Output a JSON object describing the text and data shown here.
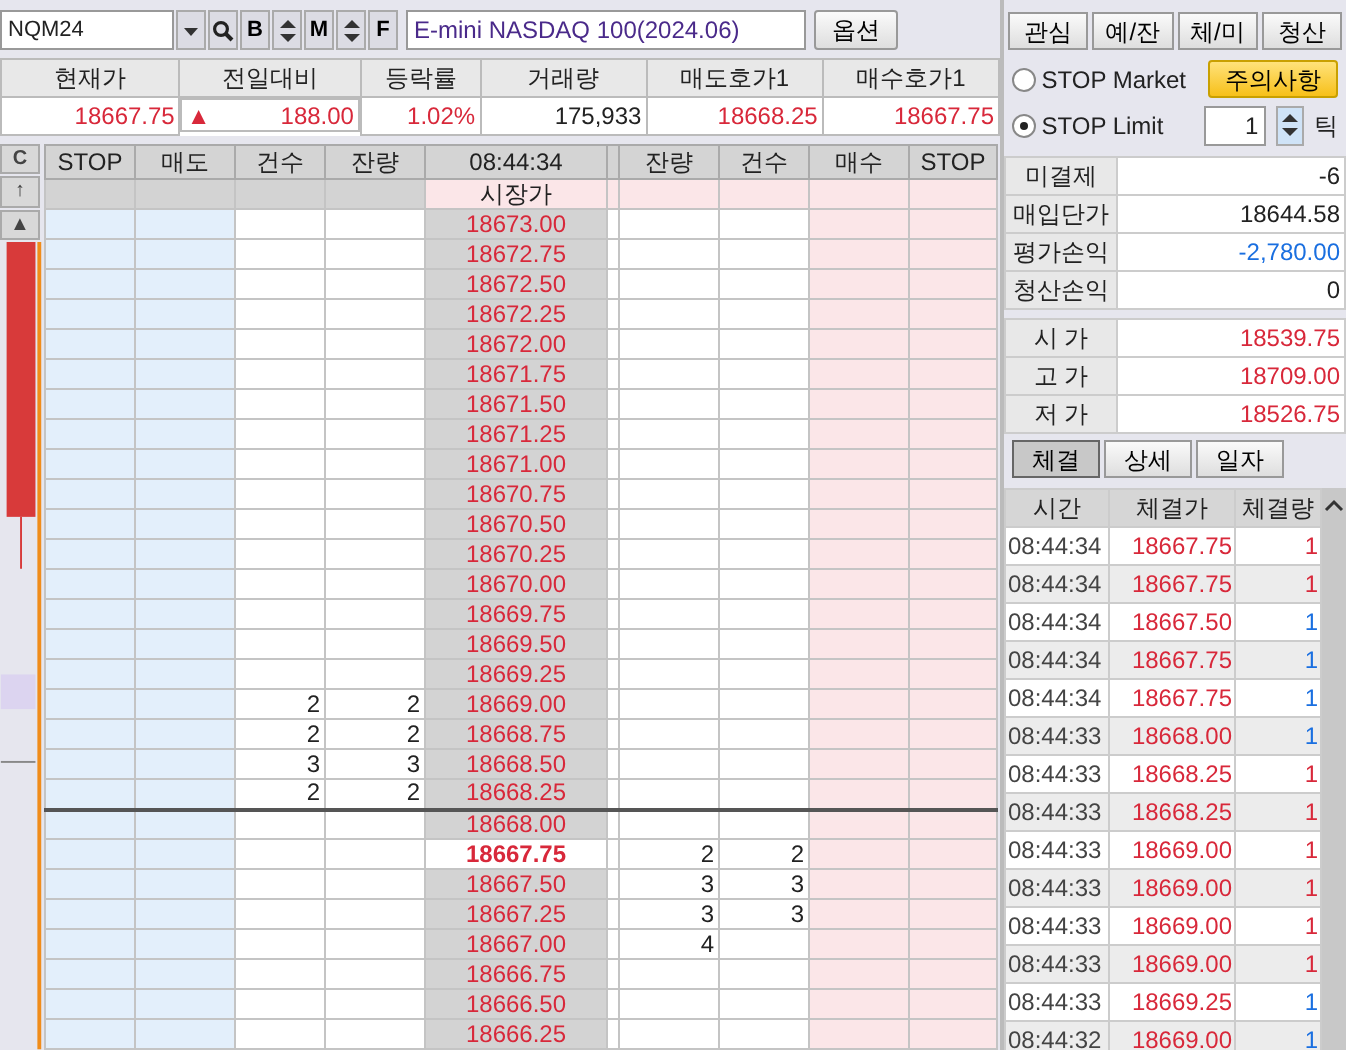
{
  "toolbar": {
    "symbol": "NQM24",
    "product_name": "E-mini NASDAQ 100(2024.06)",
    "option_button": "옵션",
    "tool_buttons": [
      "B",
      "M",
      "F"
    ]
  },
  "quote": {
    "columns": [
      "현재가",
      "전일대비",
      "등락률",
      "거래량",
      "매도호가1",
      "매수호가1"
    ],
    "values": [
      "18667.75",
      "188.00",
      "1.02%",
      "175,933",
      "18668.25",
      "18667.75"
    ],
    "change_arrow": "▲"
  },
  "order_book": {
    "side_buttons": [
      "C",
      "↑",
      "▲"
    ],
    "columns": [
      "STOP",
      "매도",
      "건수",
      "잔량",
      "08:44:34",
      "잔량",
      "건수",
      "매수",
      "STOP"
    ],
    "market_row": "시장가",
    "rows": [
      {
        "price": "18673.00",
        "sell_count": "",
        "sell_qty": "",
        "buy_qty": "",
        "buy_count": "",
        "current": false,
        "divider_above": false
      },
      {
        "price": "18672.75",
        "sell_count": "",
        "sell_qty": "",
        "buy_qty": "",
        "buy_count": "",
        "current": false,
        "divider_above": false
      },
      {
        "price": "18672.50",
        "sell_count": "",
        "sell_qty": "",
        "buy_qty": "",
        "buy_count": "",
        "current": false,
        "divider_above": false
      },
      {
        "price": "18672.25",
        "sell_count": "",
        "sell_qty": "",
        "buy_qty": "",
        "buy_count": "",
        "current": false,
        "divider_above": false
      },
      {
        "price": "18672.00",
        "sell_count": "",
        "sell_qty": "",
        "buy_qty": "",
        "buy_count": "",
        "current": false,
        "divider_above": false
      },
      {
        "price": "18671.75",
        "sell_count": "",
        "sell_qty": "",
        "buy_qty": "",
        "buy_count": "",
        "current": false,
        "divider_above": false
      },
      {
        "price": "18671.50",
        "sell_count": "",
        "sell_qty": "",
        "buy_qty": "",
        "buy_count": "",
        "current": false,
        "divider_above": false
      },
      {
        "price": "18671.25",
        "sell_count": "",
        "sell_qty": "",
        "buy_qty": "",
        "buy_count": "",
        "current": false,
        "divider_above": false
      },
      {
        "price": "18671.00",
        "sell_count": "",
        "sell_qty": "",
        "buy_qty": "",
        "buy_count": "",
        "current": false,
        "divider_above": false
      },
      {
        "price": "18670.75",
        "sell_count": "",
        "sell_qty": "",
        "buy_qty": "",
        "buy_count": "",
        "current": false,
        "divider_above": false
      },
      {
        "price": "18670.50",
        "sell_count": "",
        "sell_qty": "",
        "buy_qty": "",
        "buy_count": "",
        "current": false,
        "divider_above": false
      },
      {
        "price": "18670.25",
        "sell_count": "",
        "sell_qty": "",
        "buy_qty": "",
        "buy_count": "",
        "current": false,
        "divider_above": false
      },
      {
        "price": "18670.00",
        "sell_count": "",
        "sell_qty": "",
        "buy_qty": "",
        "buy_count": "",
        "current": false,
        "divider_above": false
      },
      {
        "price": "18669.75",
        "sell_count": "",
        "sell_qty": "",
        "buy_qty": "",
        "buy_count": "",
        "current": false,
        "divider_above": false
      },
      {
        "price": "18669.50",
        "sell_count": "",
        "sell_qty": "",
        "buy_qty": "",
        "buy_count": "",
        "current": false,
        "divider_above": false
      },
      {
        "price": "18669.25",
        "sell_count": "",
        "sell_qty": "",
        "buy_qty": "",
        "buy_count": "",
        "current": false,
        "divider_above": false
      },
      {
        "price": "18669.00",
        "sell_count": "2",
        "sell_qty": "2",
        "buy_qty": "",
        "buy_count": "",
        "current": false,
        "divider_above": false
      },
      {
        "price": "18668.75",
        "sell_count": "2",
        "sell_qty": "2",
        "buy_qty": "",
        "buy_count": "",
        "current": false,
        "divider_above": false
      },
      {
        "price": "18668.50",
        "sell_count": "3",
        "sell_qty": "3",
        "buy_qty": "",
        "buy_count": "",
        "current": false,
        "divider_above": false
      },
      {
        "price": "18668.25",
        "sell_count": "2",
        "sell_qty": "2",
        "buy_qty": "",
        "buy_count": "",
        "current": false,
        "divider_above": false
      },
      {
        "price": "18668.00",
        "sell_count": "",
        "sell_qty": "",
        "buy_qty": "",
        "buy_count": "",
        "current": false,
        "divider_above": true
      },
      {
        "price": "18667.75",
        "sell_count": "",
        "sell_qty": "",
        "buy_qty": "2",
        "buy_count": "2",
        "current": true,
        "divider_above": false
      },
      {
        "price": "18667.50",
        "sell_count": "",
        "sell_qty": "",
        "buy_qty": "3",
        "buy_count": "3",
        "current": false,
        "divider_above": false
      },
      {
        "price": "18667.25",
        "sell_count": "",
        "sell_qty": "",
        "buy_qty": "3",
        "buy_count": "3",
        "current": false,
        "divider_above": false
      },
      {
        "price": "18667.00",
        "sell_count": "",
        "sell_qty": "",
        "buy_qty": "4",
        "buy_count": "",
        "current": false,
        "divider_above": false
      },
      {
        "price": "18666.75",
        "sell_count": "",
        "sell_qty": "",
        "buy_qty": "",
        "buy_count": "",
        "current": false,
        "divider_above": false
      },
      {
        "price": "18666.50",
        "sell_count": "",
        "sell_qty": "",
        "buy_qty": "",
        "buy_count": "",
        "current": false,
        "divider_above": false
      },
      {
        "price": "18666.25",
        "sell_count": "",
        "sell_qty": "",
        "buy_qty": "",
        "buy_count": "",
        "current": false,
        "divider_above": false
      }
    ]
  },
  "side_panel": {
    "tabs": [
      "관심",
      "예/잔",
      "체/미",
      "청산"
    ],
    "stop_options": [
      {
        "label": "STOP Market",
        "selected": false
      },
      {
        "label": "STOP Limit",
        "selected": true
      }
    ],
    "notice_button": "주의사항",
    "tick_value": "1",
    "tick_unit": "틱",
    "position": [
      {
        "label": "미결제",
        "value": "-6",
        "color": "#222222"
      },
      {
        "label": "매입단가",
        "value": "18644.58",
        "color": "#222222"
      },
      {
        "label": "평가손익",
        "value": "-2,780.00",
        "color": "#1a6fe0"
      },
      {
        "label": "청산손익",
        "value": "0",
        "color": "#222222"
      }
    ],
    "prices": [
      {
        "label": "시 가",
        "value": "18539.75"
      },
      {
        "label": "고 가",
        "value": "18709.00"
      },
      {
        "label": "저 가",
        "value": "18526.75"
      }
    ],
    "trade_tabs": [
      {
        "label": "체결",
        "selected": true
      },
      {
        "label": "상세",
        "selected": false
      },
      {
        "label": "일자",
        "selected": false
      }
    ],
    "trade_columns": [
      "시간",
      "체결가",
      "체결량"
    ],
    "trades": [
      {
        "time": "08:44:34",
        "price": "18667.75",
        "qty": "1",
        "color": "#d8283a"
      },
      {
        "time": "08:44:34",
        "price": "18667.75",
        "qty": "1",
        "color": "#d8283a"
      },
      {
        "time": "08:44:34",
        "price": "18667.50",
        "qty": "1",
        "color": "#1a6fe0"
      },
      {
        "time": "08:44:34",
        "price": "18667.75",
        "qty": "1",
        "color": "#1a6fe0"
      },
      {
        "time": "08:44:34",
        "price": "18667.75",
        "qty": "1",
        "color": "#1a6fe0"
      },
      {
        "time": "08:44:33",
        "price": "18668.00",
        "qty": "1",
        "color": "#1a6fe0"
      },
      {
        "time": "08:44:33",
        "price": "18668.25",
        "qty": "1",
        "color": "#d8283a"
      },
      {
        "time": "08:44:33",
        "price": "18668.25",
        "qty": "1",
        "color": "#d8283a"
      },
      {
        "time": "08:44:33",
        "price": "18669.00",
        "qty": "1",
        "color": "#d8283a"
      },
      {
        "time": "08:44:33",
        "price": "18669.00",
        "qty": "1",
        "color": "#d8283a"
      },
      {
        "time": "08:44:33",
        "price": "18669.00",
        "qty": "1",
        "color": "#d8283a"
      },
      {
        "time": "08:44:33",
        "price": "18669.00",
        "qty": "1",
        "color": "#d8283a"
      },
      {
        "time": "08:44:33",
        "price": "18669.25",
        "qty": "1",
        "color": "#1a6fe0"
      },
      {
        "time": "08:44:32",
        "price": "18669.00",
        "qty": "1",
        "color": "#1a6fe0"
      }
    ]
  }
}
